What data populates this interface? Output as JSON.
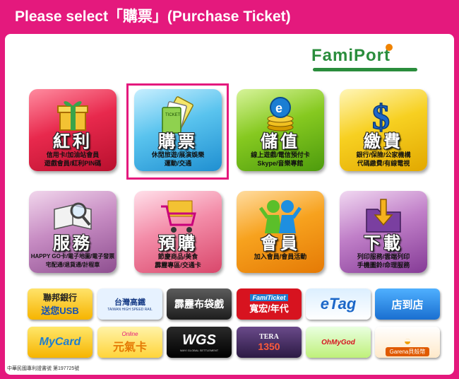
{
  "instruction": "Please select「購票」(Purchase Ticket)",
  "logo": {
    "text": "FamiPort"
  },
  "tiles": [
    {
      "title": "紅利",
      "desc": "信用卡/加油站會員\n遊戲會員/紅利PIN碼",
      "icon": "gift-box-icon"
    },
    {
      "title": "購票",
      "desc": "休閒旅遊/展演娛樂\n運動/交通",
      "icon": "tickets-icon"
    },
    {
      "title": "儲值",
      "desc": "線上遊戲/電信預付卡\nSkype/音樂專館",
      "icon": "coin-stack-icon"
    },
    {
      "title": "繳費",
      "desc": "銀行/保險/公家機構\n代碼繳費/有線電視",
      "icon": "dollar-sign-icon"
    },
    {
      "title": "服務",
      "desc": "HAPPY GO卡/電子地圖/電子發票\n宅配通/退貨通/計程車",
      "icon": "book-magnifier-icon"
    },
    {
      "title": "預購",
      "desc": "節慶商品/美食\n霹靂專區/交通卡",
      "icon": "shopping-cart-icon"
    },
    {
      "title": "會員",
      "desc": "加入會員/會員活動",
      "icon": "people-icon"
    },
    {
      "title": "下載",
      "desc": "列印服務/雲端列印\n手機圖鈴/命理服務",
      "icon": "download-folder-icon"
    }
  ],
  "partners": [
    {
      "line1": "聯邦銀行",
      "line2": "送您USB"
    },
    {
      "line1": "台灣高鐵",
      "line2": "TAIWAN HIGH SPEED RAIL"
    },
    {
      "line1": "霹靂布袋戲",
      "line2": ""
    },
    {
      "line1": "FamiTicket",
      "line2": "寬宏/年代"
    },
    {
      "line1": "eTag",
      "line2": ""
    },
    {
      "line1": "店到店",
      "line2": ""
    },
    {
      "line1": "MyCard",
      "line2": ""
    },
    {
      "line1": "Online",
      "line2": "元氣卡"
    },
    {
      "line1": "WGS",
      "line2": "WAYI GLOBAL SETTLEMENT"
    },
    {
      "line1": "TERA",
      "line2": "1350"
    },
    {
      "line1": "OhMyGod",
      "line2": ""
    },
    {
      "line1": "",
      "line2": "Garena貝殼幣"
    }
  ],
  "footer": "中華民國專利證書號 第197725號",
  "colors": {
    "frame": "#e4197d",
    "logo": "#2a8d3c",
    "logo_dot": "#f08300"
  }
}
